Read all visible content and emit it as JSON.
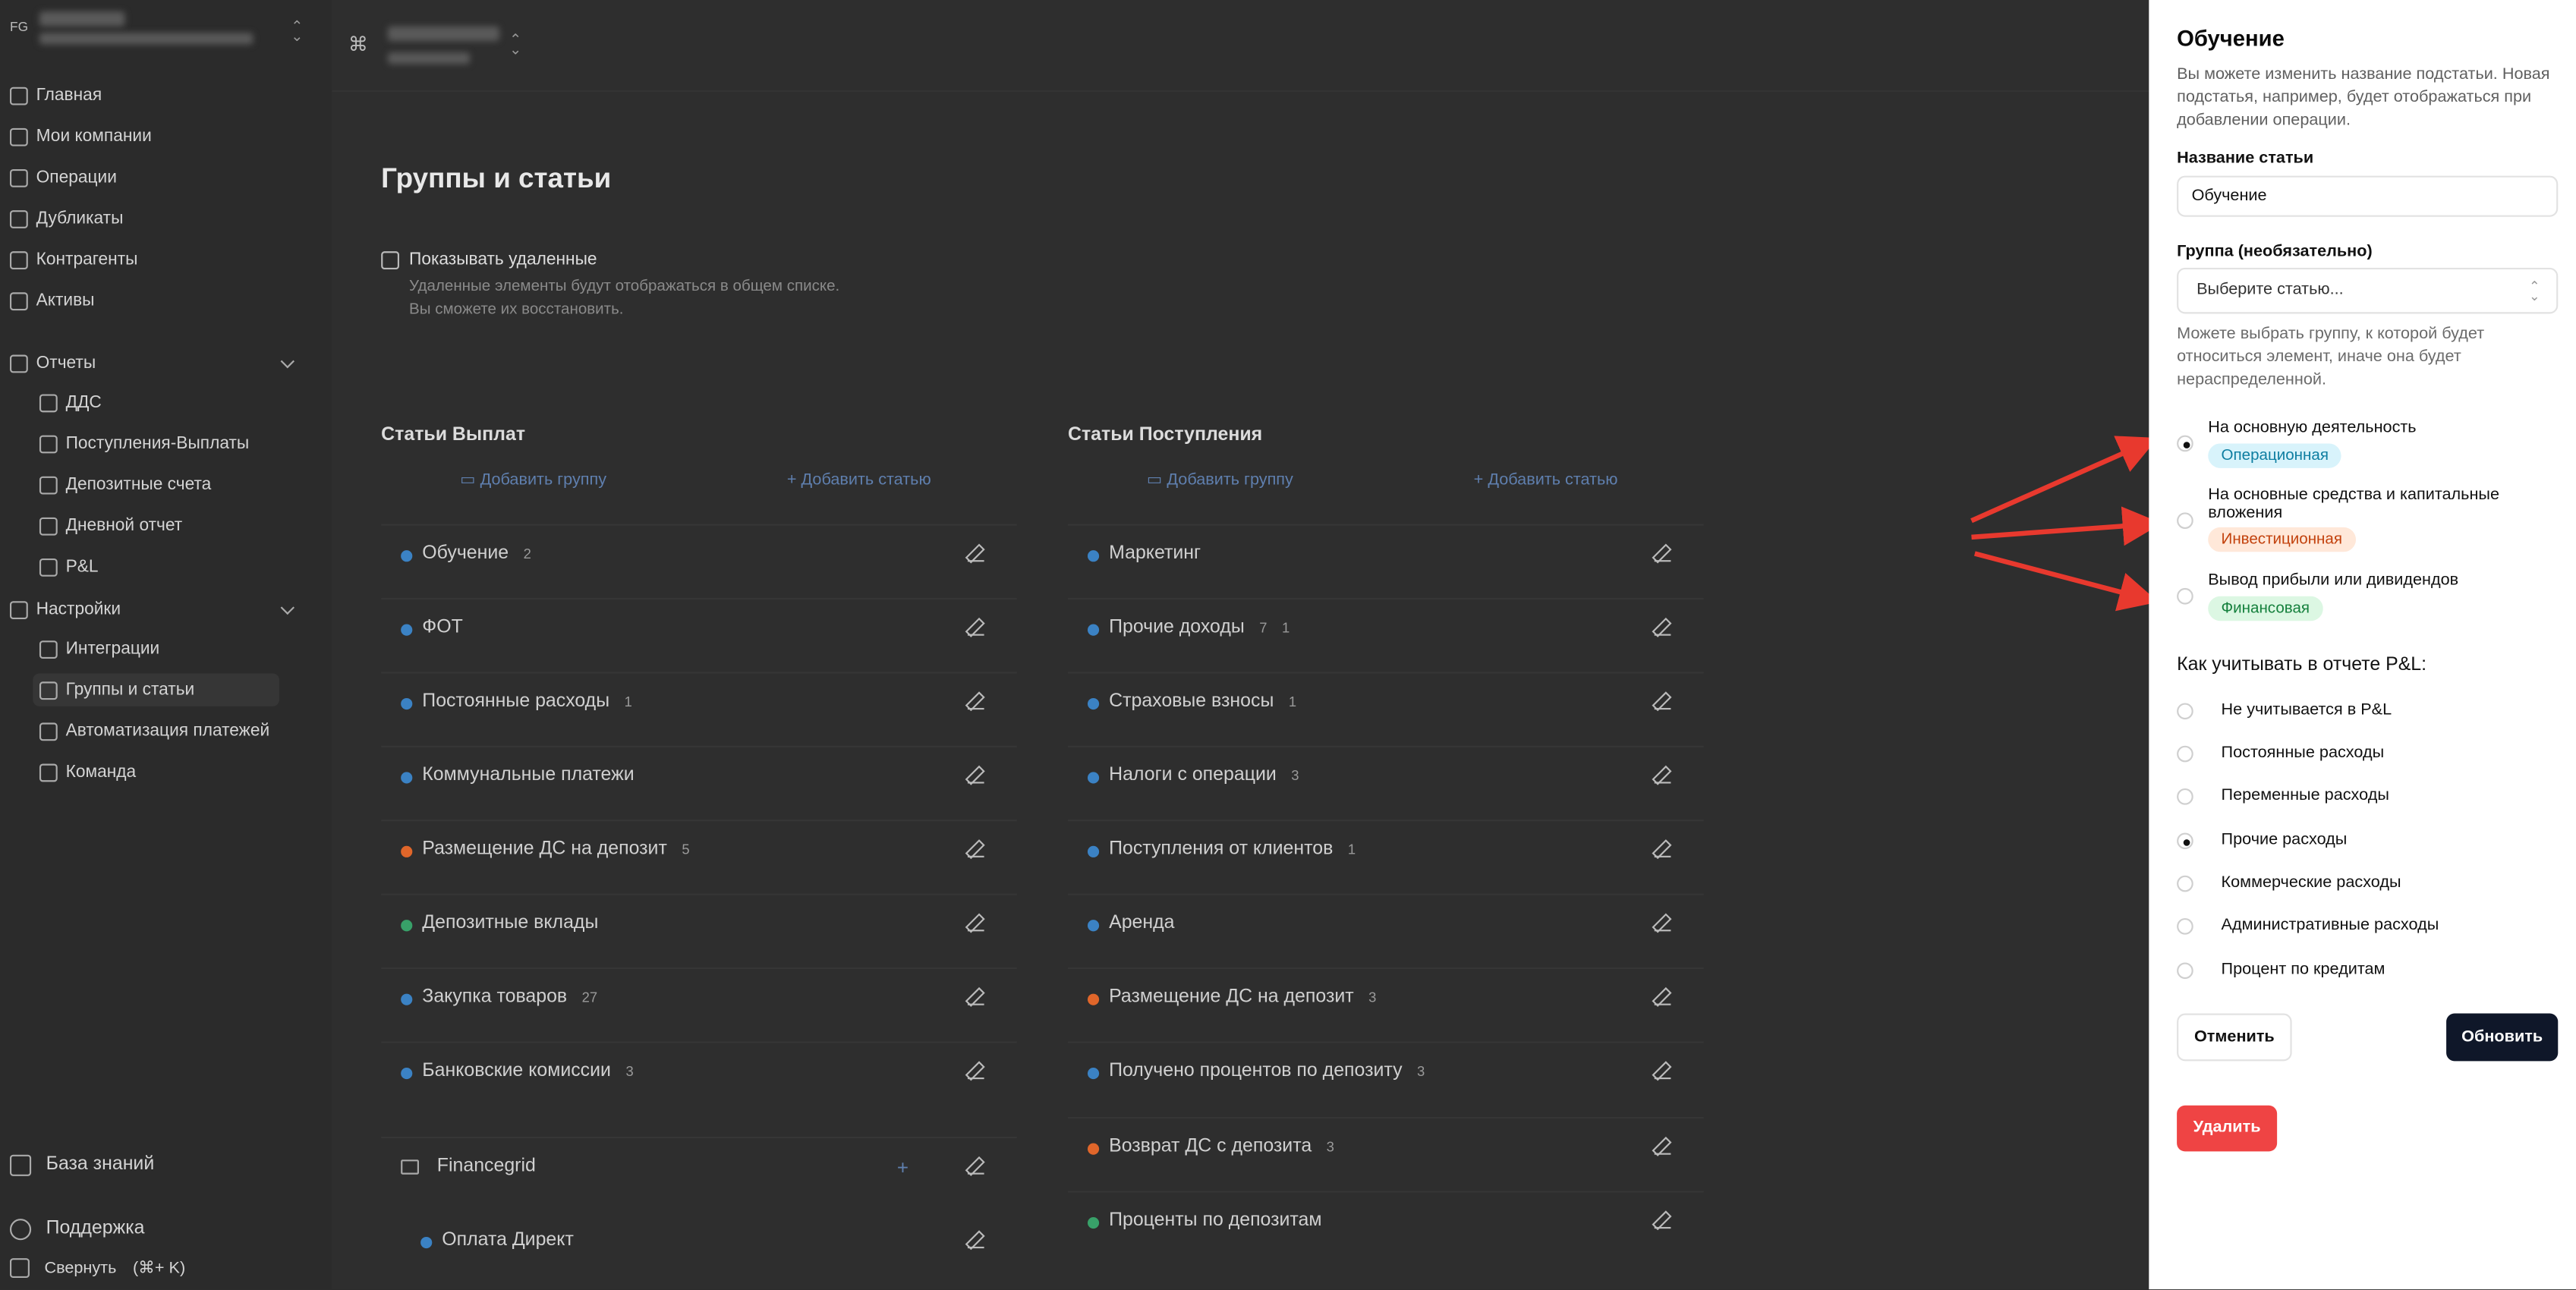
{
  "sidebar": {
    "org_initials": "FG",
    "nav": [
      {
        "label": "Главная",
        "icon": "home-icon"
      },
      {
        "label": "Мои компании",
        "icon": "building-icon"
      },
      {
        "label": "Операции",
        "icon": "receipt-icon"
      },
      {
        "label": "Дубликаты",
        "icon": "copy-icon"
      },
      {
        "label": "Контрагенты",
        "icon": "users-icon"
      },
      {
        "label": "Активы",
        "icon": "wallet-icon"
      }
    ],
    "reports": {
      "label": "Отчеты",
      "items": [
        "ДДС",
        "Поступления-Выплаты",
        "Депозитные счета",
        "Дневной отчет",
        "P&L"
      ]
    },
    "settings": {
      "label": "Настройки",
      "items": [
        "Интеграции",
        "Группы и статьи",
        "Автоматизация платежей",
        "Команда"
      ]
    },
    "footer": {
      "knowledge": "База знаний",
      "support": "Поддержка",
      "collapse": "Свернуть",
      "collapse_shortcut": "(⌘+ K)"
    }
  },
  "topbar": {
    "cmd_symbol": "⌘"
  },
  "page": {
    "title": "Группы и статьи",
    "show_deleted": {
      "label": "Показывать удаленные",
      "hint_1": "Удаленные элементы будут отображаться в общем списке.",
      "hint_2": "Вы сможете их восстановить."
    },
    "payouts": {
      "title": "Статьи Выплат",
      "add_group": "Добавить группу",
      "add_item": "Добавить статью",
      "rows": [
        {
          "name": "Обучение",
          "count": "2",
          "color": "#3b82c4"
        },
        {
          "name": "ФОТ",
          "count": "",
          "color": "#3b82c4"
        },
        {
          "name": "Постоянные расходы",
          "count": "1",
          "color": "#3b82c4"
        },
        {
          "name": "Коммунальные платежи",
          "count": "",
          "color": "#3b82c4"
        },
        {
          "name": "Размещение ДС на депозит",
          "count": "5",
          "color": "#e0662a"
        },
        {
          "name": "Депозитные вклады",
          "count": "",
          "color": "#38a169"
        },
        {
          "name": "Закупка товаров",
          "count": "27",
          "color": "#3b82c4"
        },
        {
          "name": "Банковские комиссии",
          "count": "3",
          "color": "#3b82c4"
        }
      ],
      "group": {
        "name": "Financegrid",
        "child": "Оплата Директ"
      }
    },
    "receipts": {
      "title": "Статьи Поступления",
      "add_group": "Добавить группу",
      "add_item": "Добавить статью",
      "rows": [
        {
          "name": "Маркетинг",
          "count": "",
          "color": "#3b82c4"
        },
        {
          "name": "Прочие доходы",
          "count": "7",
          "count2": "1",
          "color": "#3b82c4"
        },
        {
          "name": "Страховые взносы",
          "count": "1",
          "color": "#3b82c4"
        },
        {
          "name": "Налоги с операции",
          "count": "3",
          "color": "#3b82c4"
        },
        {
          "name": "Поступления от клиентов",
          "count": "1",
          "color": "#3b82c4"
        },
        {
          "name": "Аренда",
          "count": "",
          "color": "#3b82c4"
        },
        {
          "name": "Размещение ДС на депозит",
          "count": "3",
          "color": "#e0662a"
        },
        {
          "name": "Получено процентов по депозиту",
          "count": "3",
          "color": "#3b82c4"
        },
        {
          "name": "Возврат ДС с депозита",
          "count": "3",
          "color": "#e0662a"
        },
        {
          "name": "Проценты по депозитам",
          "count": "",
          "color": "#38a169"
        }
      ]
    }
  },
  "panel": {
    "title": "Обучение",
    "description": "Вы можете изменить название подстатьи. Новая подстатья, например, будет отображаться при добавлении операции.",
    "name_label": "Название статьи",
    "name_value": "Обучение",
    "group_label": "Группа (необязательно)",
    "group_placeholder": "Выберите статью...",
    "group_hint": "Можете выбрать группу, к которой будет относиться элемент, иначе она будет нераспределенной.",
    "activity_options": [
      {
        "title": "На основную деятельность",
        "badge": "Операционная",
        "selected": true
      },
      {
        "title": "На основные средства и капитальные вложения",
        "badge": "Инвестиционная",
        "selected": false
      },
      {
        "title": "Вывод прибыли или дивидендов",
        "badge": "Финансовая",
        "selected": false
      }
    ],
    "pl_heading": "Как учитывать в отчете P&L:",
    "pl_options": [
      {
        "label": "Не учитывается в P&L",
        "selected": false
      },
      {
        "label": "Постоянные расходы",
        "selected": false
      },
      {
        "label": "Переменные расходы",
        "selected": false
      },
      {
        "label": "Прочие расходы",
        "selected": true
      },
      {
        "label": "Коммерческие расходы",
        "selected": false
      },
      {
        "label": "Административные расходы",
        "selected": false
      },
      {
        "label": "Процент по кредитам",
        "selected": false
      }
    ],
    "cancel": "Отменить",
    "update": "Обновить",
    "delete": "Удалить"
  },
  "colors": {
    "operational_badge_bg": "#d8f3fb",
    "operational_badge_fg": "#0e7ea1",
    "investment_badge_bg": "#ffe8d9",
    "investment_badge_fg": "#c2410c",
    "financial_badge_bg": "#dcf7e3",
    "financial_badge_fg": "#15803d",
    "annotation_arrow": "#e8392e",
    "primary_button": "#0f1729",
    "danger_button": "#ef4444"
  }
}
